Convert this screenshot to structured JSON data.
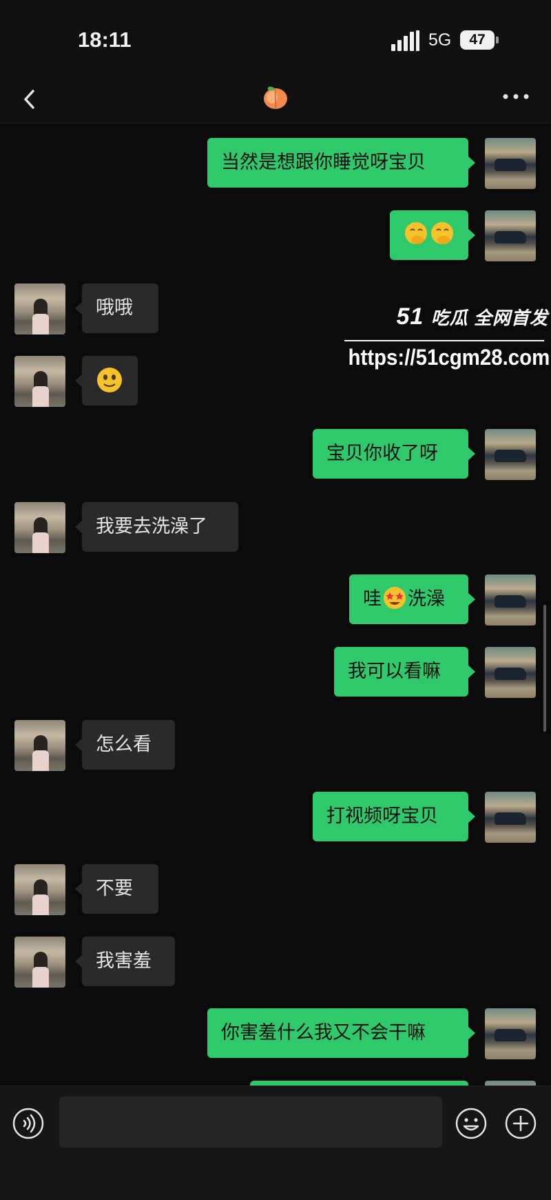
{
  "status_bar": {
    "time": "18:11",
    "network": "5G",
    "battery": "47"
  },
  "header": {
    "title_icon": "peach-emoji-icon",
    "back_icon": "chevron-left-icon",
    "more_icon": "more-dots-icon"
  },
  "messages": [
    {
      "side": "me",
      "text": "当然是想跟你睡觉呀宝贝"
    },
    {
      "side": "me",
      "text": "",
      "emoji": [
        "hand-over-mouth-emoji",
        "hand-over-mouth-emoji"
      ]
    },
    {
      "side": "her",
      "text": "哦哦"
    },
    {
      "side": "her",
      "text": "",
      "emoji": [
        "slight-smile-emoji"
      ]
    },
    {
      "side": "me",
      "text": "宝贝你收了呀"
    },
    {
      "side": "her",
      "text": "我要去洗澡了"
    },
    {
      "side": "me",
      "text_before": "哇",
      "emoji": [
        "star-struck-emoji"
      ],
      "text_after": "洗澡"
    },
    {
      "side": "me",
      "text": "我可以看嘛"
    },
    {
      "side": "her",
      "text": "怎么看"
    },
    {
      "side": "me",
      "text": "打视频呀宝贝"
    },
    {
      "side": "her",
      "text": "不要"
    },
    {
      "side": "her",
      "text": "我害羞"
    },
    {
      "side": "me",
      "text": "你害羞什么我又不会干嘛"
    }
  ],
  "watermark": {
    "brand_number": "51",
    "brand_text": "吃瓜 全网首发",
    "url": "https://51cgm28.com"
  },
  "input_bar": {
    "placeholder": "",
    "voice_icon": "voice-icon",
    "emoji_icon": "emoji-icon",
    "plus_icon": "plus-icon"
  },
  "colors": {
    "accent": "#2fc86a",
    "background": "#0b0b0b",
    "incoming_bubble": "#2a2a2a"
  }
}
